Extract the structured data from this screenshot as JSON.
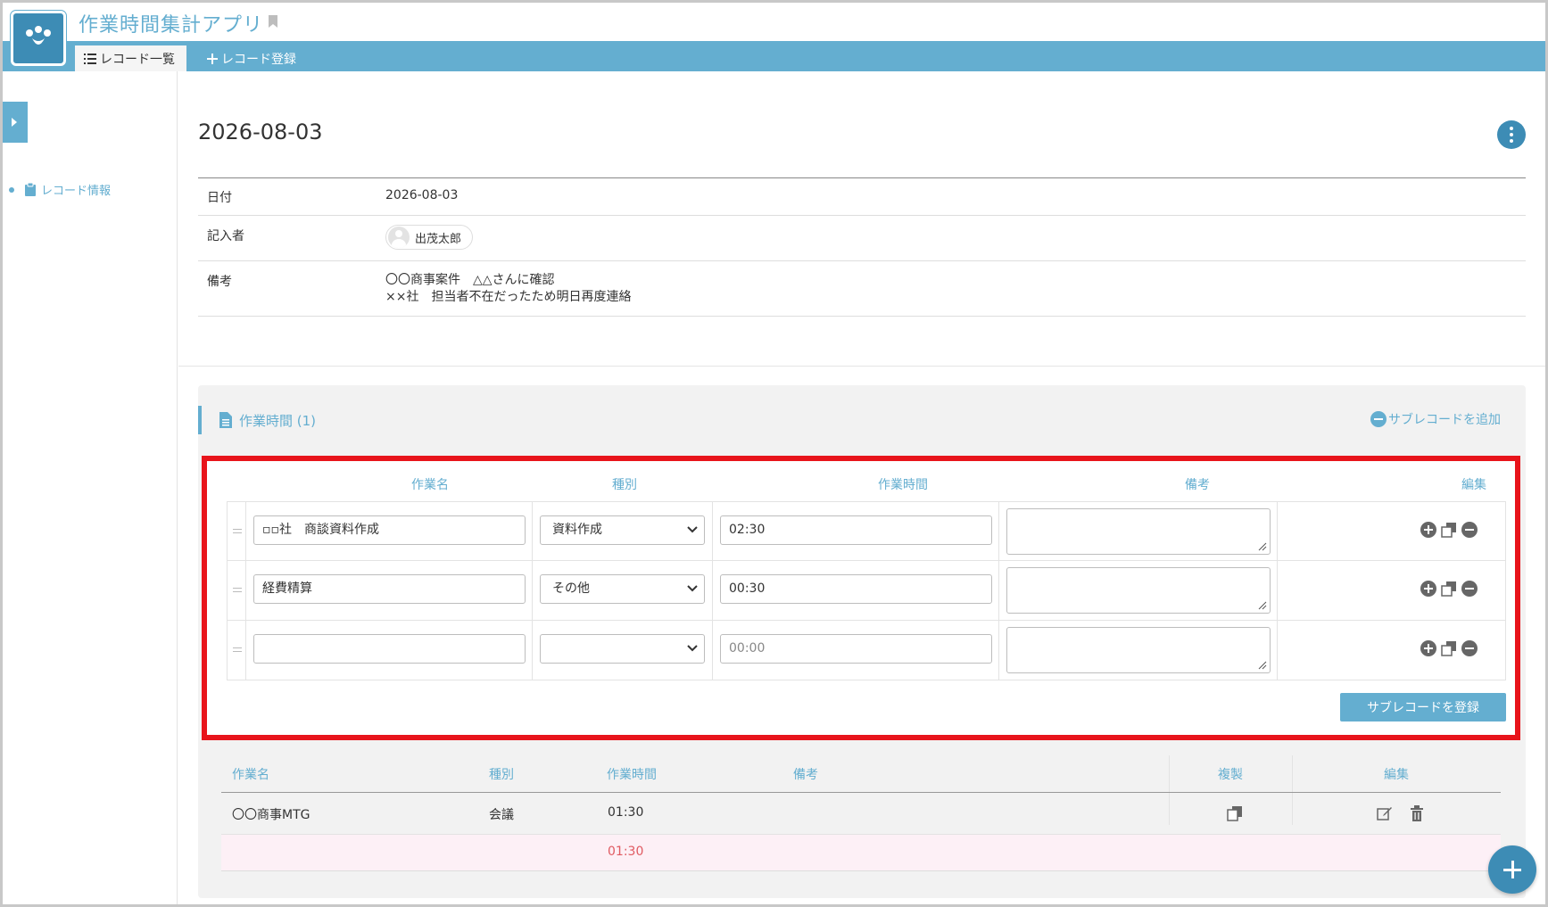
{
  "app": {
    "title": "作業時間集計アプリ",
    "tabs": [
      {
        "label": "レコード一覧",
        "icon": "list-icon"
      },
      {
        "label": "レコード登録",
        "icon": "plus-icon"
      }
    ]
  },
  "sidebar": {
    "nav_item": "レコード情報"
  },
  "record": {
    "title": "2026-08-03",
    "fields": [
      {
        "label": "日付",
        "value": "2026-08-03"
      },
      {
        "label": "記入者",
        "value": "出茂太郎"
      },
      {
        "label": "備考",
        "value_line1": "〇〇商事案件　△△さんに確認",
        "value_line2": "××社　担当者不在だったため明日再度連絡"
      }
    ]
  },
  "subtable": {
    "heading": "作業時間 (1)",
    "add_label": "サブレコードを追加",
    "edit": {
      "columns": [
        "作業名",
        "種別",
        "作業時間",
        "備考",
        "編集"
      ],
      "rows": [
        {
          "name": "▫▫社　商談資料作成",
          "type": "資料作成",
          "time": "02:30",
          "note": ""
        },
        {
          "name": "経費精算",
          "type": "その他",
          "time": "00:30",
          "note": ""
        },
        {
          "name": "",
          "type": "",
          "time_placeholder": "00:00",
          "note": ""
        }
      ],
      "submit_label": "サブレコードを登録"
    },
    "table": {
      "columns": [
        "作業名",
        "種別",
        "作業時間",
        "備考",
        "複製",
        "編集"
      ],
      "rows": [
        {
          "name": "〇〇商事MTG",
          "type": "会議",
          "time": "01:30",
          "note": ""
        }
      ],
      "total": "01:30"
    }
  },
  "colors": {
    "accent": "#64aed0",
    "accent_dark": "#3d8cb5",
    "highlight_border": "#e8141b",
    "total_text": "#e05b62"
  }
}
